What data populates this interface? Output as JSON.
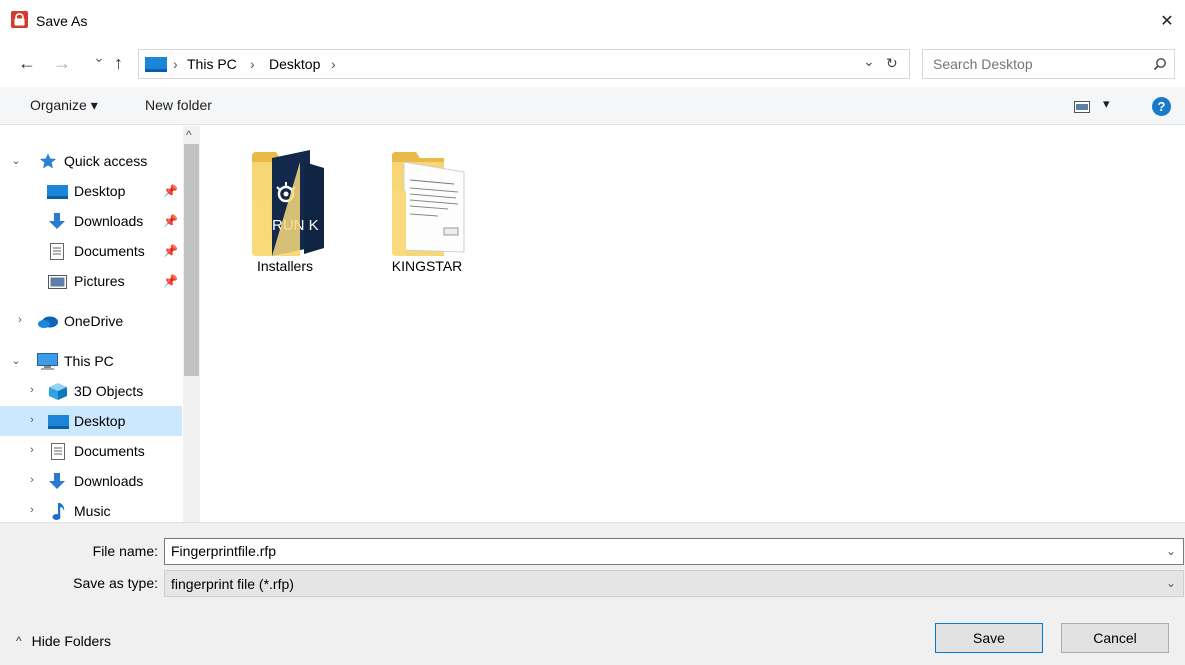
{
  "window": {
    "title": "Save As",
    "close_glyph": "✕",
    "icon": "pdf-lock-icon"
  },
  "nav": {
    "back_glyph": "←",
    "forward_glyph": "→",
    "recent_glyph": "⌄",
    "up_glyph": "↑"
  },
  "address": {
    "crumbs": [
      "This PC",
      "Desktop"
    ],
    "separator": "›",
    "dropdown_glyph": "⌄",
    "refresh_glyph": "↻"
  },
  "search": {
    "placeholder": "Search Desktop",
    "icon": "search-icon"
  },
  "toolbar": {
    "organize_label": "Organize ▾",
    "new_folder_label": "New folder",
    "view_dropdown_glyph": "▾",
    "help_glyph": "?"
  },
  "sidebar": {
    "scroll_up_glyph": "^",
    "scroll_down_glyph": "⌄",
    "items": [
      {
        "label": "Quick access",
        "chevron": "⌄",
        "icon": "star-icon",
        "pinned": false,
        "selected": false
      },
      {
        "label": "Desktop",
        "chevron": "",
        "icon": "desktop-icon",
        "pinned": true,
        "selected": false
      },
      {
        "label": "Downloads",
        "chevron": "",
        "icon": "download-arrow-icon",
        "pinned": true,
        "selected": false
      },
      {
        "label": "Documents",
        "chevron": "",
        "icon": "document-icon",
        "pinned": true,
        "selected": false
      },
      {
        "label": "Pictures",
        "chevron": "",
        "icon": "pictures-icon",
        "pinned": true,
        "selected": false
      },
      {
        "label": "OneDrive",
        "chevron": "›",
        "icon": "cloud-icon",
        "pinned": false,
        "selected": false
      },
      {
        "label": "This PC",
        "chevron": "⌄",
        "icon": "computer-icon",
        "pinned": false,
        "selected": false
      },
      {
        "label": "3D Objects",
        "chevron": "›",
        "icon": "cube-icon",
        "pinned": false,
        "selected": false
      },
      {
        "label": "Desktop",
        "chevron": "›",
        "icon": "desktop-icon",
        "pinned": false,
        "selected": true
      },
      {
        "label": "Documents",
        "chevron": "›",
        "icon": "document-icon",
        "pinned": false,
        "selected": false
      },
      {
        "label": "Downloads",
        "chevron": "›",
        "icon": "download-arrow-icon",
        "pinned": false,
        "selected": false
      },
      {
        "label": "Music",
        "chevron": "›",
        "icon": "music-note-icon",
        "pinned": false,
        "selected": false
      }
    ],
    "pin_glyph": "📌"
  },
  "content": {
    "folders": [
      {
        "name": "Installers",
        "preview": "run-logo",
        "preview_text": "RUN K"
      },
      {
        "name": "KINGSTAR",
        "preview": "document-preview",
        "preview_text": ""
      }
    ]
  },
  "bottom": {
    "filename_label": "File name:",
    "filename_value": "Fingerprintfile.rfp",
    "filetype_label": "Save as type:",
    "filetype_value": "fingerprint file (*.rfp)",
    "hide_folders_label": "Hide Folders",
    "hide_folders_glyph": "^",
    "save_label": "Save",
    "cancel_label": "Cancel"
  },
  "colors": {
    "selection": "#cce8ff",
    "accent": "#0078d7",
    "folder_yellow": "#f8d775",
    "run_navy": "#0f2a52",
    "help_blue": "#1979ca"
  }
}
